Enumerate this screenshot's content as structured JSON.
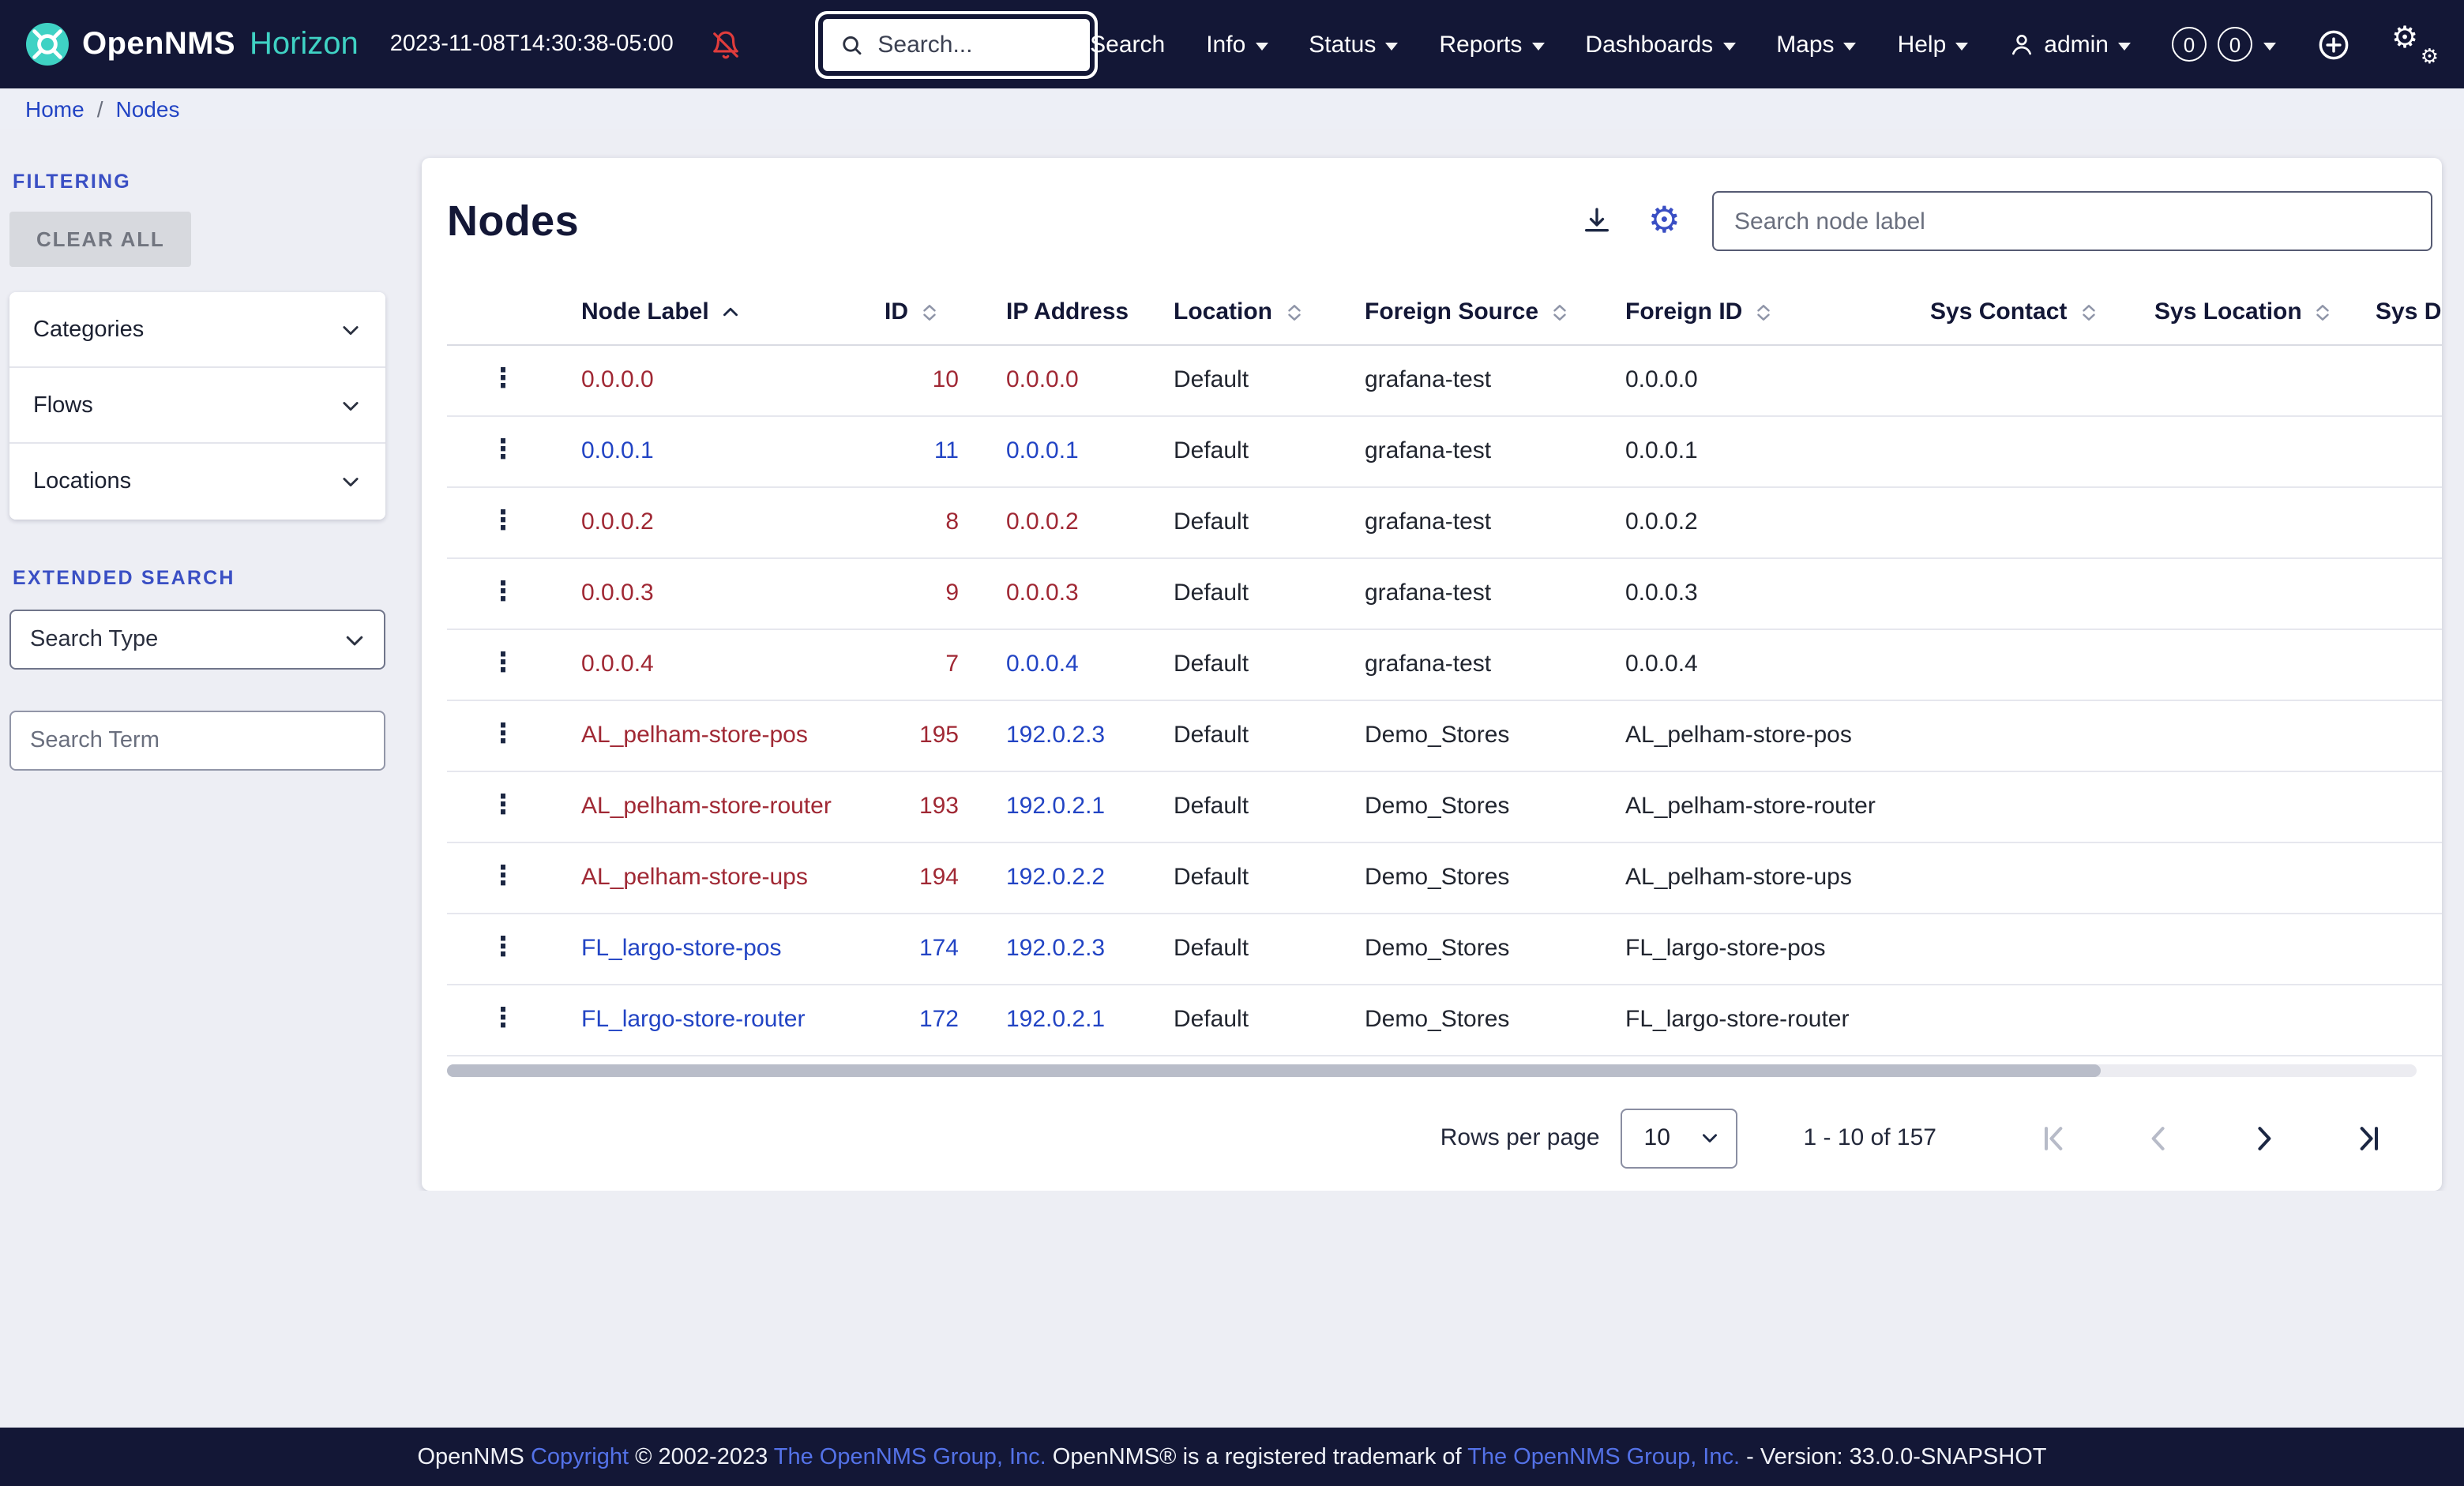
{
  "colors": {
    "navy": "#131736",
    "teal": "#3fd2c4",
    "page_bg": "#edeef4",
    "accent": "#3a4fc4",
    "link": "#2244c4",
    "visited": "#a02834",
    "danger": "#e03c3c",
    "footer_link": "#5472e8"
  },
  "navbar": {
    "brand_name": "OpenNMS",
    "brand_edition": "Horizon",
    "timestamp": "2023-11-08T14:30:38-05:00",
    "search_placeholder": "Search...",
    "items": [
      {
        "label": "Search",
        "caret": false
      },
      {
        "label": "Info",
        "caret": true
      },
      {
        "label": "Status",
        "caret": true
      },
      {
        "label": "Reports",
        "caret": true
      },
      {
        "label": "Dashboards",
        "caret": true
      },
      {
        "label": "Maps",
        "caret": true
      },
      {
        "label": "Help",
        "caret": true
      }
    ],
    "user_label": "admin",
    "badges": [
      "0",
      "0"
    ]
  },
  "breadcrumb": {
    "items": [
      "Home",
      "Nodes"
    ],
    "separator": "/"
  },
  "sidebar": {
    "filtering_label": "FILTERING",
    "clear_all_label": "CLEAR ALL",
    "accordions": [
      "Categories",
      "Flows",
      "Locations"
    ],
    "extended_search_label": "EXTENDED SEARCH",
    "search_type_placeholder": "Search Type",
    "search_term_placeholder": "Search Term"
  },
  "main": {
    "title": "Nodes",
    "search_placeholder": "Search node label",
    "table": {
      "columns": [
        {
          "label": "",
          "sort": "none"
        },
        {
          "label": "Node Label",
          "sort": "asc"
        },
        {
          "label": "ID",
          "sort": "both"
        },
        {
          "label": "IP Address",
          "sort": "none"
        },
        {
          "label": "Location",
          "sort": "both"
        },
        {
          "label": "Foreign Source",
          "sort": "both"
        },
        {
          "label": "Foreign ID",
          "sort": "both"
        },
        {
          "label": "Sys Contact",
          "sort": "both"
        },
        {
          "label": "Sys Location",
          "sort": "both"
        },
        {
          "label": "Sys D",
          "sort": "both"
        }
      ],
      "rows": [
        {
          "label": "0.0.0.0",
          "label_visited": true,
          "id": "10",
          "id_visited": true,
          "ip": "0.0.0.0",
          "ip_visited": true,
          "location": "Default",
          "foreign_source": "grafana-test",
          "foreign_id": "0.0.0.0"
        },
        {
          "label": "0.0.0.1",
          "label_visited": false,
          "id": "11",
          "id_visited": false,
          "ip": "0.0.0.1",
          "ip_visited": false,
          "location": "Default",
          "foreign_source": "grafana-test",
          "foreign_id": "0.0.0.1"
        },
        {
          "label": "0.0.0.2",
          "label_visited": true,
          "id": "8",
          "id_visited": true,
          "ip": "0.0.0.2",
          "ip_visited": true,
          "location": "Default",
          "foreign_source": "grafana-test",
          "foreign_id": "0.0.0.2"
        },
        {
          "label": "0.0.0.3",
          "label_visited": true,
          "id": "9",
          "id_visited": true,
          "ip": "0.0.0.3",
          "ip_visited": true,
          "location": "Default",
          "foreign_source": "grafana-test",
          "foreign_id": "0.0.0.3"
        },
        {
          "label": "0.0.0.4",
          "label_visited": true,
          "id": "7",
          "id_visited": true,
          "ip": "0.0.0.4",
          "ip_visited": false,
          "location": "Default",
          "foreign_source": "grafana-test",
          "foreign_id": "0.0.0.4"
        },
        {
          "label": "AL_pelham-store-pos",
          "label_visited": true,
          "id": "195",
          "id_visited": true,
          "ip": "192.0.2.3",
          "ip_visited": false,
          "location": "Default",
          "foreign_source": "Demo_Stores",
          "foreign_id": "AL_pelham-store-pos"
        },
        {
          "label": "AL_pelham-store-router",
          "label_visited": true,
          "id": "193",
          "id_visited": true,
          "ip": "192.0.2.1",
          "ip_visited": false,
          "location": "Default",
          "foreign_source": "Demo_Stores",
          "foreign_id": "AL_pelham-store-router"
        },
        {
          "label": "AL_pelham-store-ups",
          "label_visited": true,
          "id": "194",
          "id_visited": true,
          "ip": "192.0.2.2",
          "ip_visited": false,
          "location": "Default",
          "foreign_source": "Demo_Stores",
          "foreign_id": "AL_pelham-store-ups"
        },
        {
          "label": "FL_largo-store-pos",
          "label_visited": false,
          "id": "174",
          "id_visited": false,
          "ip": "192.0.2.3",
          "ip_visited": false,
          "location": "Default",
          "foreign_source": "Demo_Stores",
          "foreign_id": "FL_largo-store-pos"
        },
        {
          "label": "FL_largo-store-router",
          "label_visited": false,
          "id": "172",
          "id_visited": false,
          "ip": "192.0.2.1",
          "ip_visited": false,
          "location": "Default",
          "foreign_source": "Demo_Stores",
          "foreign_id": "FL_largo-store-router"
        }
      ]
    },
    "pagination": {
      "rows_per_page_label": "Rows per page",
      "rows_per_page": "10",
      "range": "1 - 10 of 157"
    }
  },
  "footer": {
    "segments": [
      {
        "text": "OpenNMS ",
        "link": false
      },
      {
        "text": "Copyright",
        "link": true
      },
      {
        "text": " © 2002-2023 ",
        "link": false
      },
      {
        "text": "The OpenNMS Group, Inc.",
        "link": true
      },
      {
        "text": " OpenNMS® is a registered trademark of ",
        "link": false
      },
      {
        "text": "The OpenNMS Group, Inc.",
        "link": true
      },
      {
        "text": " - Version: 33.0.0-SNAPSHOT",
        "link": false
      }
    ]
  }
}
